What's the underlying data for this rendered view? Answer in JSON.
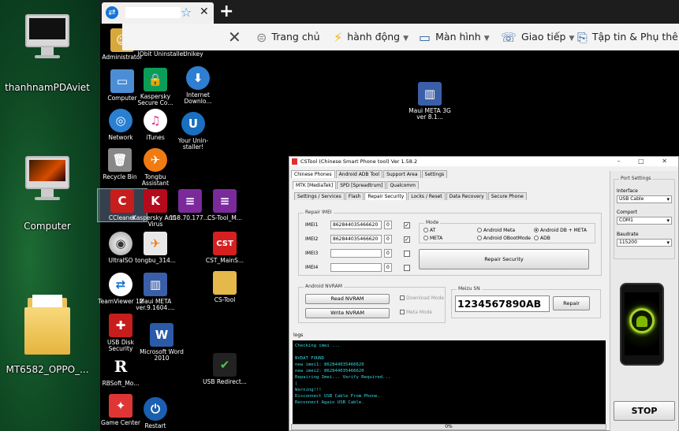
{
  "outer_desktop": {
    "icons": [
      {
        "label": "thanhnamPDAviet"
      },
      {
        "label": "Computer"
      },
      {
        "label": "MT6582_OPPO_..."
      }
    ]
  },
  "browser": {
    "new_tab_label": "+",
    "tab_close": "✕"
  },
  "toolbar": {
    "close": "✕",
    "items": [
      {
        "label": "Trang chủ"
      },
      {
        "label": "hành động"
      },
      {
        "label": "Màn hình"
      },
      {
        "label": "Giao tiếp"
      },
      {
        "label": "Tập tin & Phụ thêm"
      }
    ]
  },
  "remote_icons": [
    {
      "label": "Administrator"
    },
    {
      "label": "IObit Uninstaller"
    },
    {
      "label": "Unikey"
    },
    {
      "label": "Computer"
    },
    {
      "label": "Kaspersky Secure Co..."
    },
    {
      "label": "Internet Downlo..."
    },
    {
      "label": "Network"
    },
    {
      "label": "iTunes"
    },
    {
      "label": "Your Unin-staller!"
    },
    {
      "label": "Recycle Bin"
    },
    {
      "label": "Tongbu Assistant"
    },
    {
      "label": "CCleaner"
    },
    {
      "label": "Kaspersky Anti-Virus"
    },
    {
      "label": "118.70.177...."
    },
    {
      "label": "CS-Tool_M..."
    },
    {
      "label": "UltraISO"
    },
    {
      "label": "tongbu_314..."
    },
    {
      "label": "CST_MainS..."
    },
    {
      "label": "TeamViewer 12"
    },
    {
      "label": "Maui META ver.9.1604...."
    },
    {
      "label": "CS-Tool"
    },
    {
      "label": "USB Disk Security"
    },
    {
      "label": "Microsoft Word 2010"
    },
    {
      "label": "RBSoft_Mo..."
    },
    {
      "label": "USB Redirect..."
    },
    {
      "label": "Game Center"
    },
    {
      "label": "Restart"
    },
    {
      "label": "Maui META 3G ver 8.1..."
    }
  ],
  "cstool": {
    "title": "CSTool (Chinese Smart Phone tool) Ver 1.58.2",
    "window_buttons": "– □ ✕",
    "main_tabs": [
      "Chinese Phones",
      "Android ADB Tool",
      "Support Area",
      "Settings"
    ],
    "chip_tabs": [
      "MTK [MediaTek]",
      "SPD [Spreadtrum]",
      "Qualcomm"
    ],
    "sub_tabs": [
      "Settings / Services",
      "Flash",
      "Repair Security",
      "Locks / Reset",
      "Data Recovery",
      "Secure Phone"
    ],
    "repair_imei": {
      "title": "Repair IMEI",
      "rows": [
        {
          "label": "IMEI1",
          "value": "862844035466620",
          "count": "0",
          "checked": "✓"
        },
        {
          "label": "IMEI2",
          "value": "862844035466620",
          "count": "0",
          "checked": "✓"
        },
        {
          "label": "IMEI3",
          "value": "",
          "count": "0",
          "checked": ""
        },
        {
          "label": "IMEI4",
          "value": "",
          "count": "0",
          "checked": ""
        }
      ]
    },
    "mode": {
      "title": "Mode",
      "options": [
        "AT",
        "Android Meta",
        "Android DB + META",
        "META",
        "Android OBootMode",
        "ADB"
      ]
    },
    "repair_security_button": "Repair Security",
    "nvram": {
      "title": "Android NVRAM",
      "read": "Read NVRAM",
      "write": "Write NVRAM",
      "download_mode": "Download Mode",
      "meta_mode": "Meta Mode"
    },
    "meizu": {
      "title": "Meizu SN",
      "value": "1234567890AB",
      "repair": "Repair"
    },
    "logs": {
      "title": "logs",
      "lines": [
        "Checking imei ...",
        "",
        "NVDAT FOUND",
        "new imei1: 862844035466620",
        "new imei2: 862844035466620",
        "Repairing Imei...  Verify Required...",
        "|",
        "Warning!!!",
        "Disconnect USB Cable From Phone.",
        "Reconnect Again USB Cable."
      ]
    },
    "port_settings": {
      "title": "Port Settings",
      "interface_label": "Interface",
      "interface_value": "USB Cable",
      "comport_label": "Comport",
      "comport_value": "COM1",
      "baud_label": "Baudrate",
      "baud_value": "115200"
    },
    "stop": "STOP",
    "progress": "0%"
  },
  "colors": {
    "log_text": "#39d7dd",
    "desktop_green": "#0f4a24",
    "remote_bg": "#000000"
  }
}
